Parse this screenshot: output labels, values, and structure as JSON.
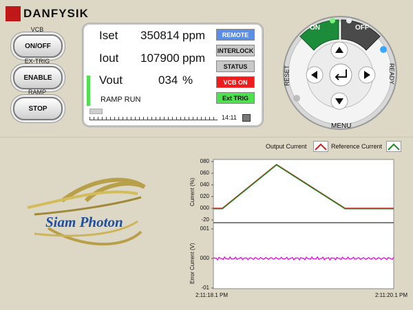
{
  "brand": "DANFYSIK",
  "controls": {
    "vcb_label": "VCB",
    "onoff_label": "ON/OFF",
    "extrig_label": "EX-TRIG",
    "enable_label": "ENABLE",
    "ramp_label": "RAMP",
    "stop_label": "STOP"
  },
  "display": {
    "iset_label": "Iset",
    "iset_value": "350814",
    "iset_unit": "ppm",
    "iout_label": "Iout",
    "iout_value": "107900",
    "iout_unit": "ppm",
    "vout_label": "Vout",
    "vout_value": "034",
    "vout_unit": "%",
    "ramp_status": "RAMP RUN",
    "time": "14:11",
    "progress": 0.1
  },
  "status_buttons": [
    {
      "label": "REMOTE",
      "color": "#5b8ee6"
    },
    {
      "label": "INTERLOCK",
      "color": "#c8c8c8"
    },
    {
      "label": "STATUS",
      "color": "#c8c8c8"
    },
    {
      "label": "VCB ON",
      "color": "#ee1c1c"
    },
    {
      "label": "Ext TRIG",
      "color": "#4fe04f"
    }
  ],
  "nav": {
    "on_label": "ON",
    "off_label": "OFF",
    "reset_label": "RESET",
    "ready_label": "READY",
    "menu_label": "MENU"
  },
  "logo_text": "Siam Photon",
  "legend": {
    "output_current": "Output Current",
    "reference_current": "Reference Current"
  },
  "chart_data": [
    {
      "type": "line",
      "ylabel": "Current (%)",
      "ylim": [
        -20,
        80
      ],
      "yticks": [
        "080",
        "060",
        "040",
        "020",
        "000",
        "-20"
      ],
      "x": [
        0,
        0.05,
        0.35,
        0.73,
        1.0
      ],
      "series": [
        {
          "name": "Output Current",
          "values": [
            0,
            0,
            75,
            0,
            0
          ],
          "color": "#d02020"
        },
        {
          "name": "Reference Current",
          "values": [
            0,
            0,
            75,
            0,
            0
          ],
          "color": "#208a20"
        }
      ]
    },
    {
      "type": "line",
      "ylabel": "Error Current (V)",
      "ylim": [
        -0.01,
        0.01
      ],
      "yticks": [
        "001",
        "000",
        "-01"
      ],
      "series": [
        {
          "name": "Error",
          "values": [
            0.0,
            0.0,
            0.0,
            0.0
          ],
          "color": "#e020e0"
        }
      ],
      "x_start": "2:11:18.1 PM",
      "x_end": "2:11:20.1 PM"
    }
  ]
}
